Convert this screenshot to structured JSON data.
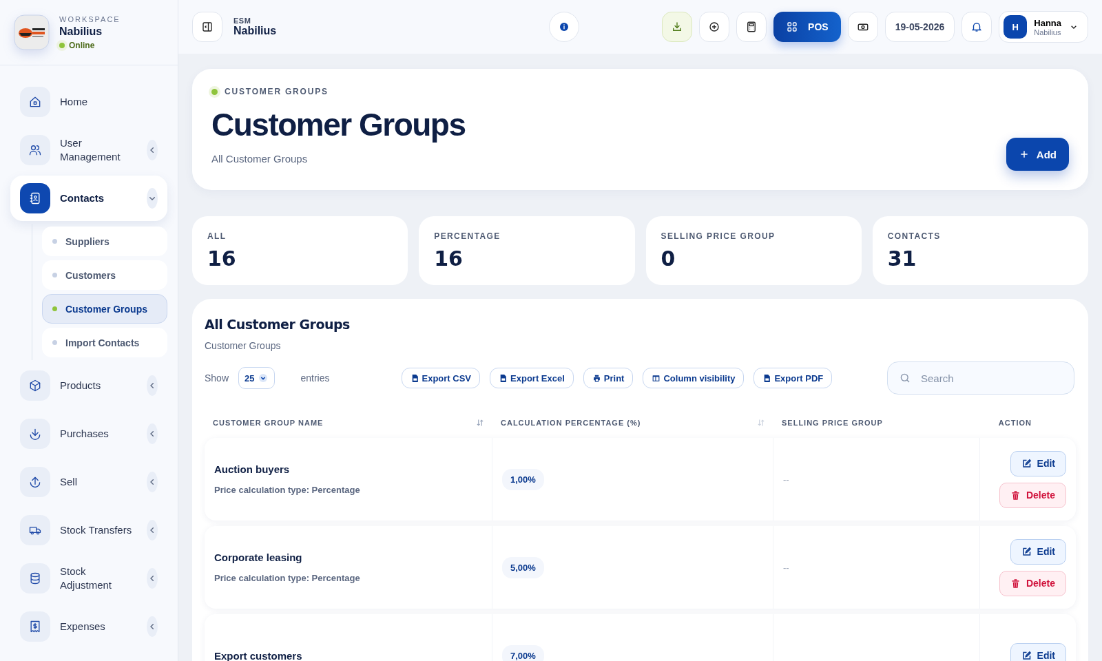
{
  "sidebar": {
    "workspace_label": "WORKSPACE",
    "workspace_name": "Nabilius",
    "status": "Online",
    "online": true,
    "nav": [
      {
        "label": "Home",
        "selected": false
      },
      {
        "label": "User Management",
        "selected": false,
        "expanded": false
      },
      {
        "label": "Contacts",
        "selected": true,
        "expanded": true,
        "children": [
          {
            "label": "Suppliers",
            "selected": false
          },
          {
            "label": "Customers",
            "selected": false
          },
          {
            "label": "Customer Groups",
            "selected": true
          },
          {
            "label": "Import Contacts",
            "selected": false
          }
        ]
      },
      {
        "label": "Products",
        "selected": false,
        "expanded": false
      },
      {
        "label": "Purchases",
        "selected": false,
        "expanded": false
      },
      {
        "label": "Sell",
        "selected": false,
        "expanded": false
      },
      {
        "label": "Stock Transfers",
        "selected": false,
        "expanded": false
      },
      {
        "label": "Stock Adjustment",
        "selected": false,
        "expanded": false
      },
      {
        "label": "Expenses",
        "selected": false,
        "expanded": false
      }
    ]
  },
  "topbar": {
    "section": "ESM",
    "title": "Nabilius",
    "pos_label": "POS",
    "date": "19-05-2026",
    "user": {
      "initial": "H",
      "name": "Hanna",
      "org": "Nabilius"
    }
  },
  "header": {
    "eyebrow": "CUSTOMER GROUPS",
    "title": "Customer Groups",
    "subtitle": "All Customer Groups",
    "add_label": "Add"
  },
  "stats": [
    {
      "label": "ALL",
      "value": "16"
    },
    {
      "label": "PERCENTAGE",
      "value": "16"
    },
    {
      "label": "SELLING PRICE GROUP",
      "value": "0"
    },
    {
      "label": "CONTACTS",
      "value": "31"
    }
  ],
  "table": {
    "title": "All Customer Groups",
    "subtitle": "Customer Groups",
    "show_label": "Show",
    "page_size": "25",
    "entries_label": "entries",
    "exports": [
      "Export CSV",
      "Export Excel",
      "Print",
      "Column visibility",
      "Export PDF"
    ],
    "search": {
      "placeholder": "Search"
    },
    "columns": [
      {
        "label": "CUSTOMER GROUP NAME",
        "sortable": true
      },
      {
        "label": "CALCULATION PERCENTAGE (%)",
        "sortable": true
      },
      {
        "label": "SELLING PRICE GROUP",
        "sortable": false
      },
      {
        "label": "ACTION",
        "sortable": false
      }
    ],
    "rows": [
      {
        "name": "Auction buyers",
        "type": "Price calculation type: Percentage",
        "percentage": "1,00%",
        "selling_price_group": "--",
        "actions": [
          {
            "kind": "edit",
            "label": "Edit"
          },
          {
            "kind": "delete",
            "label": "Delete"
          }
        ]
      },
      {
        "name": "Corporate leasing",
        "type": "Price calculation type: Percentage",
        "percentage": "5,00%",
        "selling_price_group": "--",
        "actions": [
          {
            "kind": "edit",
            "label": "Edit"
          },
          {
            "kind": "delete",
            "label": "Delete"
          }
        ]
      },
      {
        "name": "Export customers",
        "percentage": "7,00%",
        "actions": [
          {
            "kind": "edit",
            "label": "Edit"
          }
        ]
      }
    ]
  }
}
